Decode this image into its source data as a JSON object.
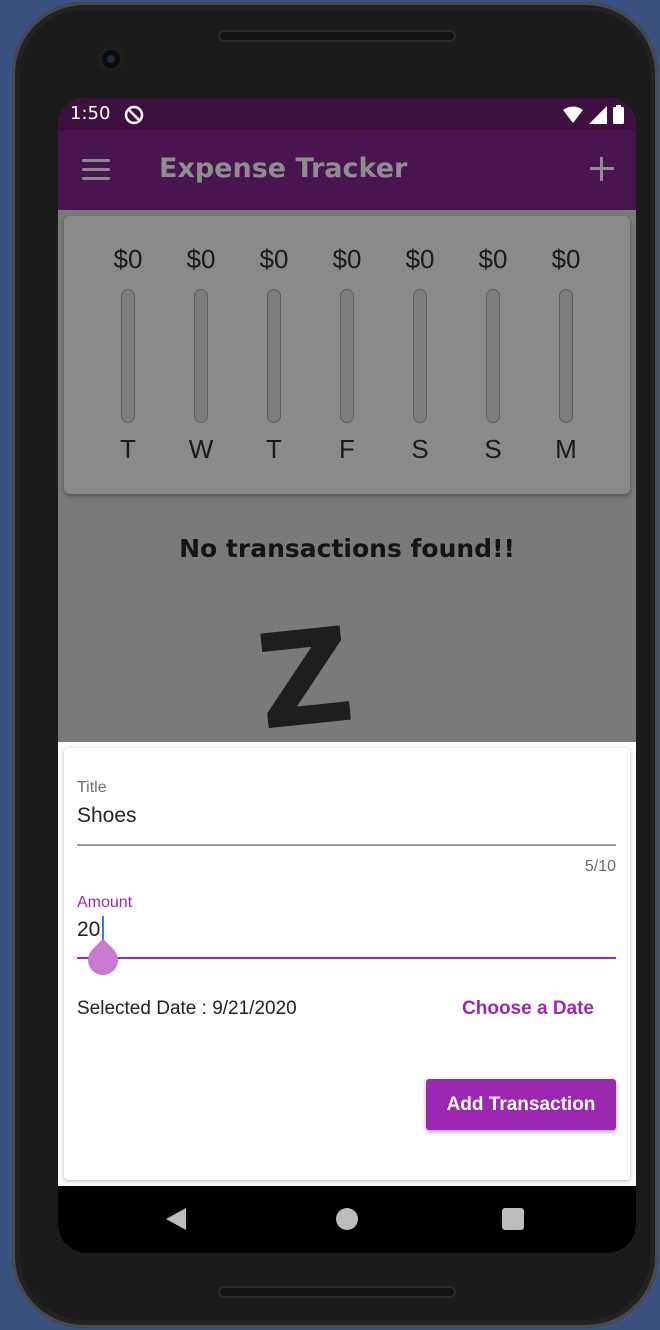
{
  "status_bar": {
    "time": "1:50",
    "icons": [
      "do-not-disturb-icon",
      "wifi-icon",
      "signal-icon",
      "battery-icon"
    ]
  },
  "app_bar": {
    "title": "Expense Tracker",
    "menu_icon": "menu-icon",
    "add_icon": "plus-icon",
    "background": "#4a1450"
  },
  "weekly_chart": {
    "bars": [
      {
        "day": "T",
        "amount": "$0",
        "fill_fraction": 0
      },
      {
        "day": "W",
        "amount": "$0",
        "fill_fraction": 0
      },
      {
        "day": "T",
        "amount": "$0",
        "fill_fraction": 0
      },
      {
        "day": "F",
        "amount": "$0",
        "fill_fraction": 0
      },
      {
        "day": "S",
        "amount": "$0",
        "fill_fraction": 0
      },
      {
        "day": "S",
        "amount": "$0",
        "fill_fraction": 0
      },
      {
        "day": "M",
        "amount": "$0",
        "fill_fraction": 0
      }
    ]
  },
  "transactions": {
    "empty_message": "No transactions found!!",
    "empty_image_text": "Z"
  },
  "new_transaction_form": {
    "title_field": {
      "label": "Title",
      "value": "Shoes",
      "counter": "5/10"
    },
    "amount_field": {
      "label": "Amount",
      "value": "20"
    },
    "selected_date": "Selected Date : 9/21/2020",
    "choose_date_label": "Choose a Date",
    "submit_label": "Add Transaction",
    "accent_color": "#9c27b0"
  },
  "nav_bar": {
    "icons": [
      "back-icon",
      "home-icon",
      "recents-icon"
    ]
  }
}
